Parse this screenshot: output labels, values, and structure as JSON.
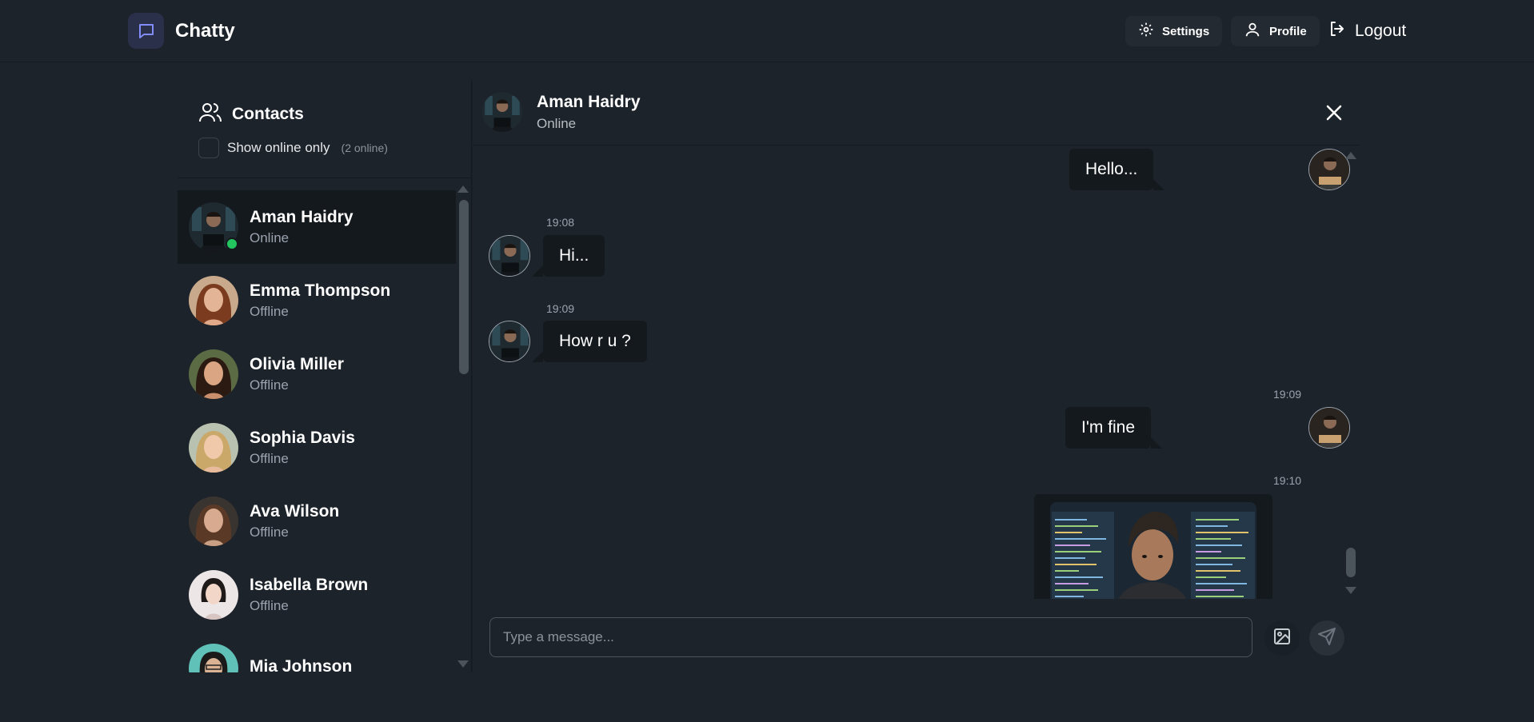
{
  "app": {
    "name": "Chatty",
    "accent": "#6366f1"
  },
  "nav": {
    "settings_label": "Settings",
    "profile_label": "Profile",
    "logout_label": "Logout"
  },
  "sidebar": {
    "title": "Contacts",
    "filter_label": "Show online only",
    "online_count": "(2 online)",
    "contacts": [
      {
        "name": "Aman Haidry",
        "status": "Online",
        "active": true
      },
      {
        "name": "Emma Thompson",
        "status": "Offline"
      },
      {
        "name": "Olivia Miller",
        "status": "Offline"
      },
      {
        "name": "Sophia Davis",
        "status": "Offline"
      },
      {
        "name": "Ava Wilson",
        "status": "Offline"
      },
      {
        "name": "Isabella Brown",
        "status": "Offline"
      },
      {
        "name": "Mia Johnson",
        "status": ""
      }
    ]
  },
  "chat": {
    "header": {
      "name": "Aman Haidry",
      "status": "Online"
    },
    "messages": [
      {
        "text": "Hello...",
        "direction": "out",
        "time": ""
      },
      {
        "text": "Hi...",
        "direction": "in",
        "time": "19:08"
      },
      {
        "text": "How r u ?",
        "direction": "in",
        "time": "19:09"
      },
      {
        "text": "I'm fine",
        "direction": "out",
        "time": "19:09"
      },
      {
        "type": "image",
        "direction": "out",
        "time": "19:10"
      }
    ],
    "composer": {
      "placeholder": "Type a message..."
    }
  },
  "colors": {
    "online": "#22c55e",
    "background": "#1d232a",
    "bubble": "#14191e"
  }
}
